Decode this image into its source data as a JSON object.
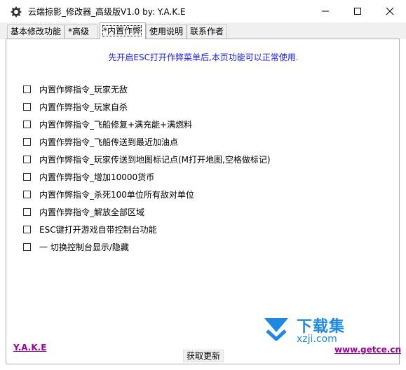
{
  "window": {
    "title": "云端掠影_修改器_高级版V1.0 by: Y.A.K.E"
  },
  "tabs": [
    {
      "label": "基本修改功能"
    },
    {
      "label": "*高级"
    },
    {
      "label": "*内置作弊"
    },
    {
      "label": "使用说明"
    },
    {
      "label": "联系作者"
    }
  ],
  "main": {
    "notice": "先开启ESC打开作弊菜单后,本页功能可以正常使用.",
    "options": [
      {
        "label": "内置作弊指令_玩家无敌",
        "checked": false
      },
      {
        "label": "内置作弊指令_玩家自杀",
        "checked": false
      },
      {
        "label": "内置作弊指令_飞船修复+满充能+满燃料",
        "checked": false
      },
      {
        "label": "内置作弊指令_飞船传送到最近加油点",
        "checked": false
      },
      {
        "label": "内置作弊指令_玩家传送到地图标记点(M打开地图,空格做标记)",
        "checked": false
      },
      {
        "label": "内置作弊指令_增加10000货币",
        "checked": false
      },
      {
        "label": "内置作弊指令_杀死100单位所有敌对单位",
        "checked": false
      },
      {
        "label": "内置作弊指令_解放全部区域",
        "checked": false
      },
      {
        "label": "ESC键打开游戏自带控制台功能",
        "checked": false
      },
      {
        "label": "一  切换控制台显示/隐藏",
        "checked": false
      }
    ]
  },
  "footer": {
    "author": "Y.A.K.E",
    "update_button": "获取更新"
  },
  "watermark": {
    "title": "下载集",
    "domain": "xzji.com",
    "site": "www.getce.cn"
  },
  "colors": {
    "notice": "#1a1aff",
    "link": "#a000a0",
    "watermark": "#1e88e5"
  }
}
